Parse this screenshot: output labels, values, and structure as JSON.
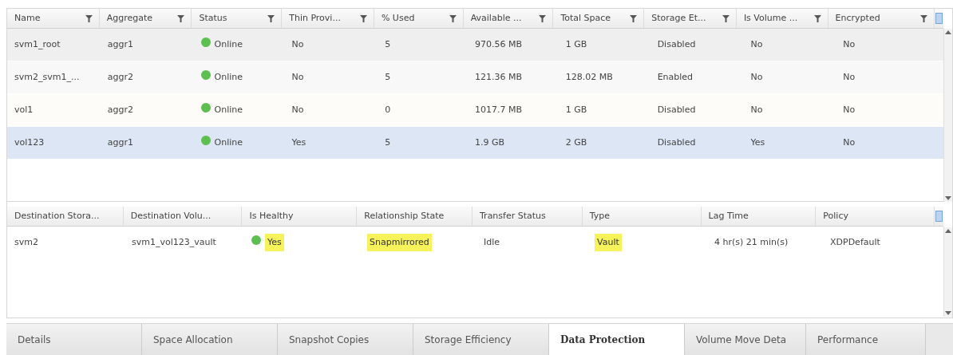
{
  "volumes": {
    "columns": [
      {
        "label": "Name",
        "kind": "text"
      },
      {
        "label": "Aggregate",
        "kind": "text"
      },
      {
        "label": "Status",
        "kind": "status"
      },
      {
        "label": "Thin Provi...",
        "kind": "text"
      },
      {
        "label": "% Used",
        "kind": "text"
      },
      {
        "label": "Available ...",
        "kind": "text"
      },
      {
        "label": "Total Space",
        "kind": "text"
      },
      {
        "label": "Storage Et...",
        "kind": "text"
      },
      {
        "label": "Is Volume ...",
        "kind": "text"
      },
      {
        "label": "Encrypted",
        "kind": "text"
      }
    ],
    "rows": [
      {
        "selected": false,
        "cells": [
          "svm1_root",
          "aggr1",
          "Online",
          "No",
          "5",
          "970.56 MB",
          "1 GB",
          "Disabled",
          "No",
          "No"
        ]
      },
      {
        "selected": false,
        "cells": [
          "svm2_svm1_...",
          "aggr2",
          "Online",
          "No",
          "5",
          "121.36 MB",
          "128.02 MB",
          "Enabled",
          "No",
          "No"
        ]
      },
      {
        "selected": false,
        "cells": [
          "vol1",
          "aggr2",
          "Online",
          "No",
          "0",
          "1017.7 MB",
          "1 GB",
          "Disabled",
          "No",
          "No"
        ]
      },
      {
        "selected": true,
        "cells": [
          "vol123",
          "aggr1",
          "Online",
          "Yes",
          "5",
          "1.9 GB",
          "2 GB",
          "Disabled",
          "Yes",
          "No"
        ]
      }
    ]
  },
  "relationships": {
    "columns": [
      {
        "label": "Destination Stora...",
        "kind": "text"
      },
      {
        "label": "Destination Volu...",
        "kind": "text"
      },
      {
        "label": "Is Healthy",
        "kind": "status"
      },
      {
        "label": "Relationship State",
        "kind": "text"
      },
      {
        "label": "Transfer Status",
        "kind": "text"
      },
      {
        "label": "Type",
        "kind": "text"
      },
      {
        "label": "Lag Time",
        "kind": "text"
      },
      {
        "label": "Policy",
        "kind": "text"
      }
    ],
    "rows": [
      {
        "cells": [
          {
            "text": "svm2",
            "highlighted": false
          },
          {
            "text": "svm1_vol123_vault",
            "highlighted": false
          },
          {
            "text": "Yes",
            "highlighted": true
          },
          {
            "text": "Snapmirrored",
            "highlighted": true
          },
          {
            "text": "Idle",
            "highlighted": false
          },
          {
            "text": "Vault",
            "highlighted": true
          },
          {
            "text": "4 hr(s) 21 min(s)",
            "highlighted": false
          },
          {
            "text": "XDPDefault",
            "highlighted": false
          }
        ]
      }
    ]
  },
  "tabs": [
    {
      "label": "Details",
      "selected": false
    },
    {
      "label": "Space Allocation",
      "selected": false
    },
    {
      "label": "Snapshot Copies",
      "selected": false
    },
    {
      "label": "Storage Efficiency",
      "selected": false
    },
    {
      "label": "Data Protection",
      "selected": true
    },
    {
      "label": "Volume Move Deta",
      "selected": false
    },
    {
      "label": "Performance",
      "selected": false
    }
  ]
}
